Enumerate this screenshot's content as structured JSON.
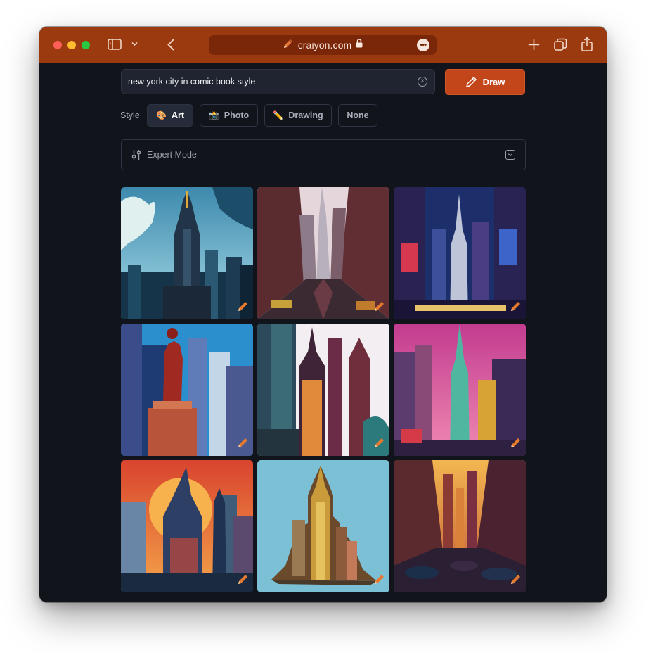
{
  "browser": {
    "url": "craiyon.com",
    "colors": {
      "titlebar": "#9c3a0f",
      "address_bar": "#7a2608"
    }
  },
  "prompt": {
    "value": "new york city in comic book style"
  },
  "draw_button": {
    "label": "Draw"
  },
  "style": {
    "label": "Style",
    "options": [
      {
        "label": "Art",
        "icon": "palette-icon",
        "emoji": "🎨",
        "active": true
      },
      {
        "label": "Photo",
        "icon": "camera-icon",
        "emoji": "📸",
        "active": false
      },
      {
        "label": "Drawing",
        "icon": "pencil-icon",
        "emoji": "✏️",
        "active": false
      },
      {
        "label": "None",
        "icon": "",
        "emoji": "",
        "active": false
      }
    ]
  },
  "expert_mode": {
    "label": "Expert Mode"
  },
  "results": {
    "count": 9,
    "images": [
      {
        "id": "image-1",
        "sky": "#5aa7c9"
      },
      {
        "id": "image-2",
        "sky": "#e9dbe0"
      },
      {
        "id": "image-3",
        "sky": "#1f3a7a"
      },
      {
        "id": "image-4",
        "sky": "#2d8fd1"
      },
      {
        "id": "image-5",
        "sky": "#f4eef0"
      },
      {
        "id": "image-6",
        "sky": "#d94f9a"
      },
      {
        "id": "image-7",
        "sky": "#f28a3c"
      },
      {
        "id": "image-8",
        "sky": "#7cbfd6"
      },
      {
        "id": "image-9",
        "sky": "#f2b450"
      }
    ]
  },
  "colors": {
    "accent": "#c2461a",
    "background": "#11141b"
  }
}
